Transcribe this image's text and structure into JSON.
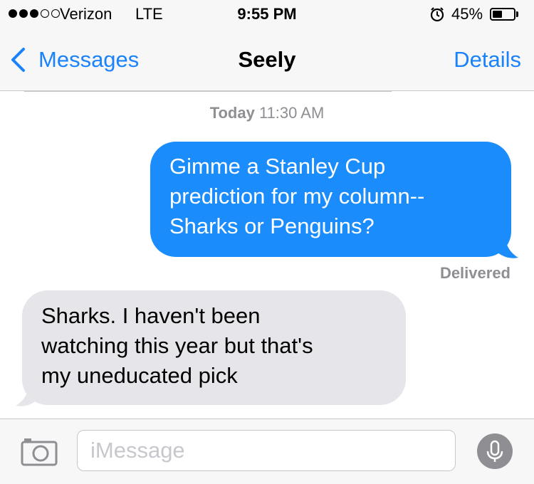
{
  "status_bar": {
    "signal_dots_filled": 3,
    "signal_dots_total": 5,
    "carrier": "Verizon",
    "network": "LTE",
    "time": "9:55 PM",
    "alarm_icon": "alarm-clock-icon",
    "battery_percent": "45%",
    "battery_level": 0.45
  },
  "nav": {
    "back_label": "Messages",
    "back_icon": "chevron-left-icon",
    "title": "Seely",
    "details_label": "Details"
  },
  "conversation": {
    "timestamp_day": "Today",
    "timestamp_time": "11:30 AM",
    "sent_message": {
      "lines": [
        "Gimme a Stanley Cup",
        "prediction for my column--",
        "Sharks or Penguins?"
      ]
    },
    "delivered_label": "Delivered",
    "received_message": {
      "lines": [
        "Sharks. I haven't been",
        "watching this year but that's",
        "my uneducated pick"
      ]
    }
  },
  "input_bar": {
    "camera_icon": "camera-icon",
    "placeholder": "iMessage",
    "mic_icon": "microphone-icon"
  },
  "colors": {
    "accent": "#1a82fb",
    "sent_bubble": "#1a8cfb",
    "received_bubble": "#e5e5ea",
    "bar_background": "#f7f7f8",
    "secondary_text": "#8e8e93"
  }
}
